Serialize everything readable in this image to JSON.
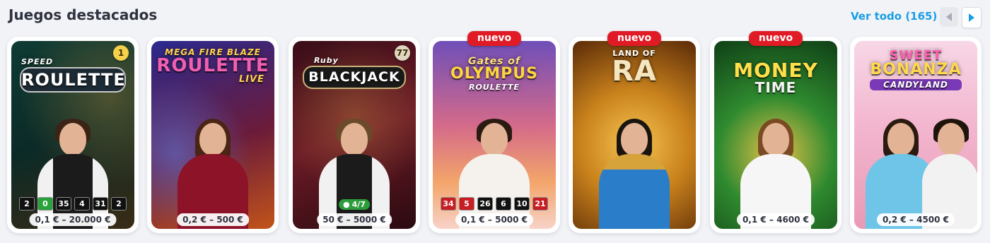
{
  "header": {
    "title": "Juegos destacados",
    "view_all": "Ver todo (165)"
  },
  "games": [
    {
      "name_top": "SPEED",
      "name_main": "ROULETTE",
      "name_sub": "",
      "badge": "",
      "corner": "1",
      "limits": "0,1 € – 20.000 €",
      "results": [
        {
          "v": "2",
          "c": "black"
        },
        {
          "v": "0",
          "c": "green"
        },
        {
          "v": "35",
          "c": "black"
        },
        {
          "v": "4",
          "c": "black"
        },
        {
          "v": "31",
          "c": "black"
        },
        {
          "v": "2",
          "c": "black"
        }
      ],
      "players": ""
    },
    {
      "name_top": "MEGA FIRE BLAZE",
      "name_main": "ROULETTE",
      "name_sub": "LIVE",
      "badge": "",
      "corner": "",
      "limits": "0,2 € – 500 €",
      "results": [],
      "players": ""
    },
    {
      "name_top": "Ruby",
      "name_main": "BLACKJACK",
      "name_sub": "",
      "badge": "",
      "corner": "77",
      "limits": "50 € – 5000 €",
      "results": [],
      "players": "4/7"
    },
    {
      "name_top": "Gates of",
      "name_main": "OLYMPUS",
      "name_sub": "ROULETTE",
      "badge": "nuevo",
      "corner": "",
      "limits": "0,1 € – 5000 €",
      "results": [
        {
          "v": "34",
          "c": "red"
        },
        {
          "v": "5",
          "c": "red"
        },
        {
          "v": "26",
          "c": "black"
        },
        {
          "v": "6",
          "c": "black"
        },
        {
          "v": "10",
          "c": "black"
        },
        {
          "v": "21",
          "c": "red"
        }
      ],
      "players": ""
    },
    {
      "name_top": "LAND OF",
      "name_main": "RA",
      "name_sub": "",
      "badge": "nuevo",
      "corner": "",
      "limits": "",
      "results": [],
      "players": ""
    },
    {
      "name_top": "",
      "name_main": "MONEY",
      "name_sub": "TIME",
      "badge": "nuevo",
      "corner": "",
      "limits": "0,1 € – 4600 €",
      "results": [],
      "players": ""
    },
    {
      "name_top": "SWEET",
      "name_main": "BONANZA",
      "name_sub": "CANDYLAND",
      "badge": "",
      "corner": "",
      "limits": "0,2 € – 4500 €",
      "results": [],
      "players": ""
    }
  ],
  "colors": {
    "accent": "#1a9ee3",
    "new_badge": "#e11b26",
    "title": "#2f3340"
  }
}
